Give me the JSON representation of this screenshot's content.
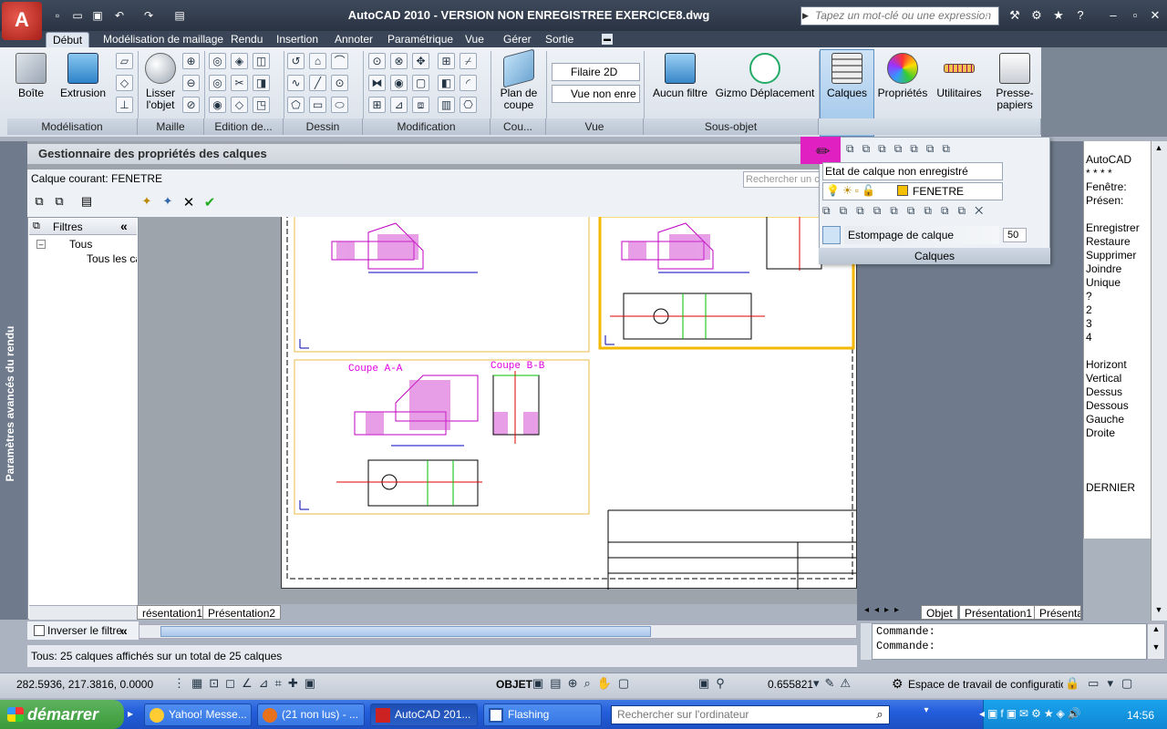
{
  "app": {
    "title": "AutoCAD 2010 - VERSION NON ENREGISTREE    EXERCICE8.dwg",
    "search_placeholder": "Tapez un mot-clé ou une expression"
  },
  "tabs": [
    "Début",
    "Modélisation de maillage",
    "Rendu",
    "Insertion",
    "Annoter",
    "Paramétrique",
    "Vue",
    "Gérer",
    "Sortie"
  ],
  "ribbon": {
    "boite": "Boîte",
    "extrusion": "Extrusion",
    "lisser": "Lisser l'objet",
    "plan_coupe": "Plan de coupe",
    "filaire": "Filaire 2D",
    "vue_non_enre": "Vue non enre",
    "aucun_filtre": "Aucun filtre",
    "gizmo": "Gizmo Déplacement",
    "calques": "Calques",
    "proprietes": "Propriétés",
    "utilitaires": "Utilitaires",
    "presse_papiers": "Presse-papiers",
    "panels": [
      "Modélisation",
      "Maille",
      "Edition de...",
      "Dessin",
      "Modification",
      "Cou...",
      "Vue",
      "Sous-objet"
    ]
  },
  "layer_manager": {
    "title": "Gestionnaire des propriétés des calques",
    "current": "Calque courant: FENETRE",
    "filters_label": "Filtres",
    "tree_all": "Tous",
    "tree_used": "Tous les calques utilisés",
    "invert_filter": "Inverser le filtre",
    "status": "Tous: 25 calques affichés sur un total de 25 calques",
    "search_placeholder": "Rechercher un calque",
    "side_label": "Paramètres avancés du rendu"
  },
  "layer_popup": {
    "state": "Etat de calque non enregistré",
    "layer": "FENETRE",
    "lock_fade": "Estompage de calque verrouillé",
    "fade_value": "50",
    "panel": "Calques"
  },
  "right_menu": [
    "AutoCAD",
    "* * * *",
    "Fenêtre:",
    "Présen:",
    "",
    "Enregistrer",
    "Restaure",
    "Supprimer",
    "Joindre",
    "Unique",
    "?",
    "2",
    "3",
    "4",
    "",
    "Horizont",
    "Vertical",
    "Dessus",
    "Dessous",
    "Gauche",
    "Droite",
    "",
    "",
    "",
    "DERNIER"
  ],
  "drawing": {
    "coupe_aa": "Coupe A-A",
    "coupe_bb": "Coupe B-B"
  },
  "layout_tabs": {
    "left": [
      "résentation1",
      "Présentation2"
    ],
    "right": [
      "Objet",
      "Présentation1",
      "Présenta"
    ]
  },
  "command": [
    "Commande:",
    "Commande:"
  ],
  "status_bar": {
    "coords": "282.5936, 217.3816, 0.0000",
    "objet": "OBJET",
    "scale": "0.655821",
    "workspace": "Espace de travail de configuratio"
  },
  "taskbar": {
    "start": "démarrer",
    "items": [
      "Yahoo! Messe...",
      "(21 non lus) - ...",
      "AutoCAD 201...",
      "Flashing"
    ],
    "search": "Rechercher sur l'ordinateur",
    "clock": "14:56"
  },
  "colors": {
    "magenta": "#e000e0",
    "accent": "#ff00ff",
    "yellow_frame": "#f5b800"
  }
}
